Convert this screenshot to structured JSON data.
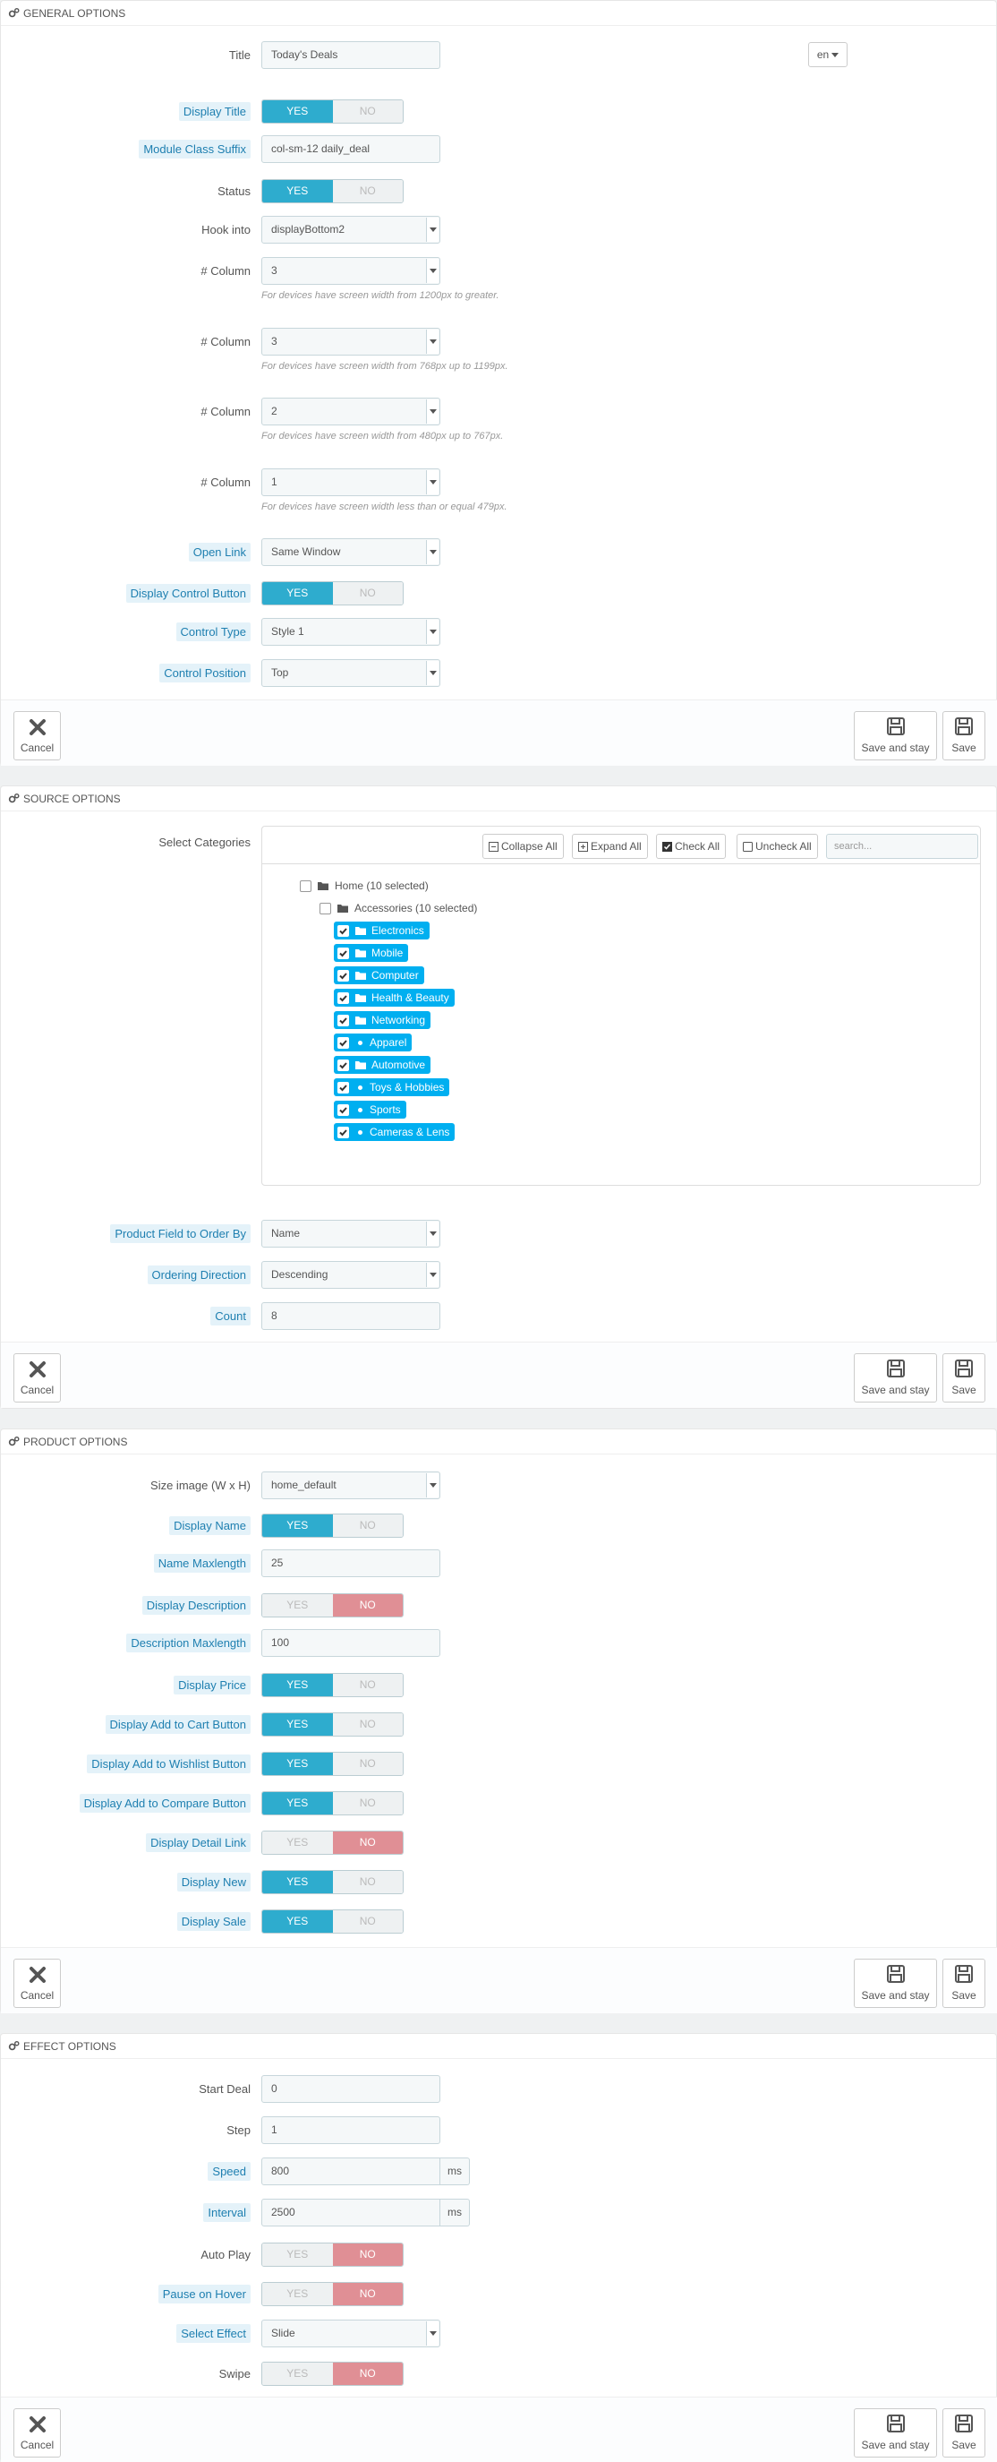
{
  "general": {
    "heading": "GENERAL OPTIONS",
    "title_label": "Title",
    "title_value": "Today's Deals",
    "lang": "en",
    "display_title_label": "Display Title",
    "suffix_label": "Module Class Suffix",
    "suffix_value": "col-sm-12 daily_deal",
    "status_label": "Status",
    "hook_label": "Hook into",
    "hook_value": "displayBottom2",
    "col1_label": "# Column",
    "col1_value": "3",
    "col1_help": "For devices have screen width from 1200px to greater.",
    "col2_label": "# Column",
    "col2_value": "3",
    "col2_help": "For devices have screen width from 768px up to 1199px.",
    "col3_label": "# Column",
    "col3_value": "2",
    "col3_help": "For devices have screen width from 480px up to 767px.",
    "col4_label": "# Column",
    "col4_value": "1",
    "col4_help": "For devices have screen width less than or equal 479px.",
    "open_link_label": "Open Link",
    "open_link_value": "Same Window",
    "control_button_label": "Display Control Button",
    "control_type_label": "Control Type",
    "control_type_value": "Style 1",
    "control_position_label": "Control Position",
    "control_position_value": "Top"
  },
  "switch": {
    "yes": "YES",
    "no": "NO"
  },
  "buttons": {
    "cancel": "Cancel",
    "save_stay": "Save and stay",
    "save": "Save"
  },
  "source": {
    "heading": "SOURCE OPTIONS",
    "categories_label": "Select Categories",
    "collapse_all": "Collapse All",
    "expand_all": "Expand All",
    "check_all": "Check All",
    "uncheck_all": "Uncheck All",
    "search_placeholder": "search...",
    "home": "Home (10 selected)",
    "accessories": "Accessories (10 selected)",
    "items": [
      "Electronics",
      "Mobile",
      "Computer",
      "Health & Beauty",
      "Networking",
      "Apparel",
      "Automotive",
      "Toys & Hobbies",
      "Sports",
      "Cameras & Lens"
    ],
    "order_by_label": "Product Field to Order By",
    "order_by_value": "Name",
    "direction_label": "Ordering Direction",
    "direction_value": "Descending",
    "count_label": "Count",
    "count_value": "8"
  },
  "product": {
    "heading": "PRODUCT OPTIONS",
    "size_label": "Size image (W x H)",
    "size_value": "home_default",
    "display_name_label": "Display Name",
    "name_max_label": "Name Maxlength",
    "name_max_value": "25",
    "display_desc_label": "Display Description",
    "desc_max_label": "Description Maxlength",
    "desc_max_value": "100",
    "display_price_label": "Display Price",
    "add_cart_label": "Display Add to Cart Button",
    "add_wishlist_label": "Display Add to Wishlist Button",
    "add_compare_label": "Display Add to Compare Button",
    "detail_link_label": "Display Detail Link",
    "display_new_label": "Display New",
    "display_sale_label": "Display Sale"
  },
  "effect": {
    "heading": "EFFECT OPTIONS",
    "start_label": "Start Deal",
    "start_value": "0",
    "step_label": "Step",
    "step_value": "1",
    "speed_label": "Speed",
    "speed_value": "800",
    "speed_unit": "ms",
    "interval_label": "Interval",
    "interval_value": "2500",
    "interval_unit": "ms",
    "autoplay_label": "Auto Play",
    "pause_label": "Pause on Hover",
    "select_effect_label": "Select Effect",
    "select_effect_value": "Slide",
    "swipe_label": "Swipe"
  }
}
